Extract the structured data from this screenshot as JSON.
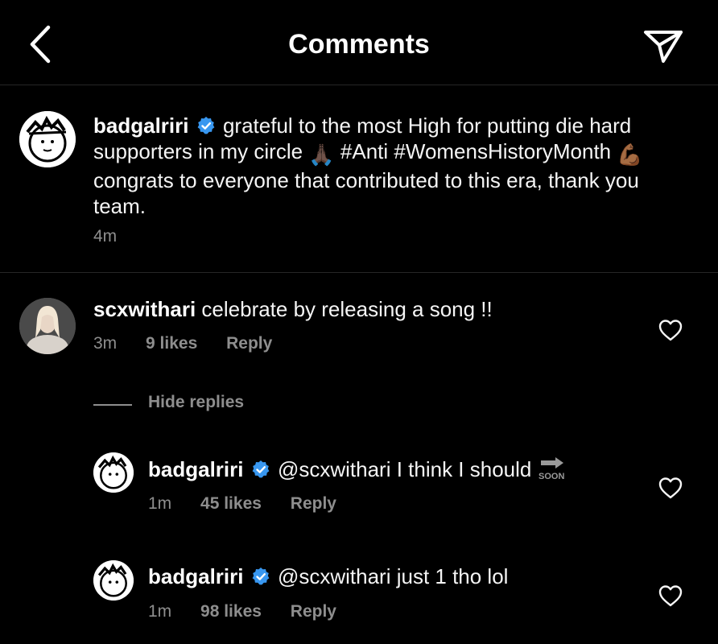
{
  "header": {
    "title": "Comments",
    "back_icon": "chevron-left-icon",
    "send_icon": "send-icon"
  },
  "caption": {
    "username": "badgalriri",
    "text_part1": "grateful to the most High for putting die hard supporters in my circle",
    "emoji1": "🙏🏿",
    "text_part2": "#Anti #WomensHistoryMonth",
    "emoji2": "💪🏾",
    "text_part3": "congrats to everyone that contributed to this era, thank you team.",
    "time": "4m"
  },
  "comments": [
    {
      "username": "scxwithari",
      "text": "celebrate by releasing a song !!",
      "time": "3m",
      "likes": "9 likes",
      "reply_label": "Reply"
    }
  ],
  "hide_replies_label": "Hide replies",
  "replies": [
    {
      "username": "badgalriri",
      "text": "@scxwithari I think I should",
      "emoji": "🔜",
      "time": "1m",
      "likes": "45 likes",
      "reply_label": "Reply"
    },
    {
      "username": "badgalriri",
      "text": "@scxwithari just 1 tho lol",
      "time": "1m",
      "likes": "98 likes",
      "reply_label": "Reply"
    }
  ],
  "colors": {
    "background": "#000000",
    "text": "#f5f5f5",
    "meta": "#8e8e8e",
    "verified": "#3897f0",
    "divider": "#262626"
  }
}
